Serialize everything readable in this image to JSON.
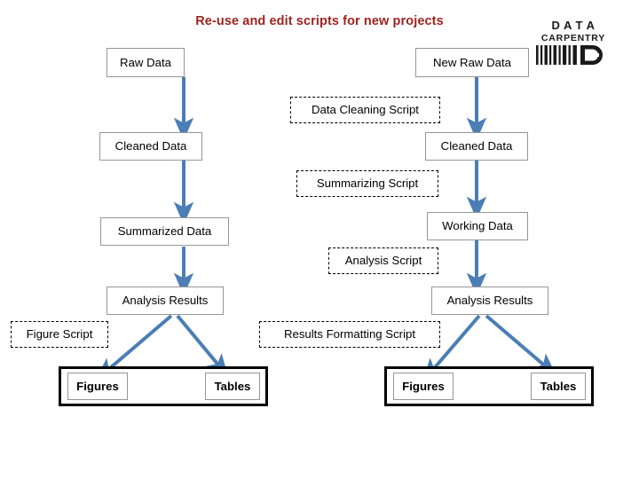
{
  "title": "Re-use and edit scripts for new projects",
  "logo": {
    "line1": "D A T A",
    "line2": "CARPENTRY",
    "mark_letter": "D",
    "alt": "data-carpentry-logo"
  },
  "colors": {
    "title": "#9c2420",
    "arrow": "#4a7eb5",
    "data_box_border": "#969696",
    "script_box_border": "#000000",
    "group_border": "#000000",
    "background": "#ffffff"
  },
  "left_pipeline": {
    "nodes": [
      {
        "id": "raw-data",
        "label": "Raw Data",
        "kind": "data"
      },
      {
        "id": "cleaned-data-left",
        "label": "Cleaned Data",
        "kind": "data"
      },
      {
        "id": "summarized-data",
        "label": "Summarized Data",
        "kind": "data"
      },
      {
        "id": "analysis-results-left",
        "label": "Analysis Results",
        "kind": "data"
      }
    ],
    "scripts": [
      {
        "id": "figure-script",
        "label": "Figure Script",
        "kind": "script"
      }
    ],
    "outputs": [
      {
        "id": "figures-left",
        "label": "Figures"
      },
      {
        "id": "tables-left",
        "label": "Tables"
      }
    ]
  },
  "right_pipeline": {
    "nodes": [
      {
        "id": "new-raw-data",
        "label": "New Raw Data",
        "kind": "data"
      },
      {
        "id": "cleaned-data-right",
        "label": "Cleaned Data",
        "kind": "data"
      },
      {
        "id": "working-data",
        "label": "Working Data",
        "kind": "data"
      },
      {
        "id": "analysis-results-right",
        "label": "Analysis Results",
        "kind": "data"
      }
    ],
    "scripts": [
      {
        "id": "results-formatting-script",
        "label": "Results Formatting Script",
        "kind": "script"
      }
    ],
    "outputs": [
      {
        "id": "figures-right",
        "label": "Figures"
      },
      {
        "id": "tables-right",
        "label": "Tables"
      }
    ]
  },
  "shared_scripts": [
    {
      "id": "data-cleaning-script",
      "label": "Data Cleaning Script",
      "kind": "script"
    },
    {
      "id": "summarizing-script",
      "label": "Summarizing Script",
      "kind": "script"
    },
    {
      "id": "analysis-script",
      "label": "Analysis Script",
      "kind": "script"
    }
  ]
}
